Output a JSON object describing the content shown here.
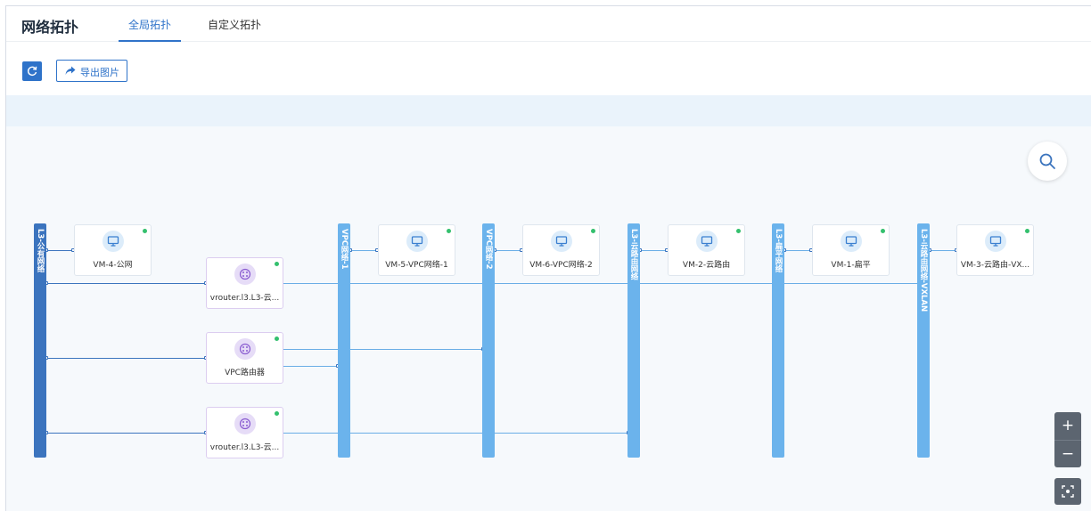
{
  "header": {
    "title": "网络拓扑",
    "tabs": [
      {
        "label": "全局拓扑",
        "active": true
      },
      {
        "label": "自定义拓扑",
        "active": false
      }
    ]
  },
  "toolbar": {
    "refresh_icon": "refresh-icon",
    "export_label": "导出图片",
    "export_icon": "share-arrow-icon"
  },
  "topology": {
    "networks": [
      {
        "label": "L3-公有网络",
        "color": "#3b74be"
      },
      {
        "label": "VPC网络-1",
        "color": "#6bb3ec"
      },
      {
        "label": "VPC网络-2",
        "color": "#6bb3ec"
      },
      {
        "label": "L3-云路由网络",
        "color": "#6bb3ec"
      },
      {
        "label": "L3-扁平网络",
        "color": "#6bb3ec"
      },
      {
        "label": "L3-云路由网络-VXLAN",
        "color": "#6bb3ec"
      }
    ],
    "vms": [
      {
        "label": "VM-4-公网",
        "status": "running"
      },
      {
        "label": "VM-5-VPC网络-1",
        "status": "running"
      },
      {
        "label": "VM-6-VPC网络-2",
        "status": "running"
      },
      {
        "label": "VM-2-云路由",
        "status": "running"
      },
      {
        "label": "VM-1-扁平",
        "status": "running"
      },
      {
        "label": "VM-3-云路由-VX...",
        "status": "running"
      }
    ],
    "routers": [
      {
        "label": "vrouter.l3.L3-云...",
        "status": "running"
      },
      {
        "label": "VPC路由器",
        "status": "running"
      },
      {
        "label": "vrouter.l3.L3-云...",
        "status": "running"
      }
    ],
    "status_color": "#34c06e",
    "vm_icon": "monitor-icon",
    "router_icon": "router-icon"
  },
  "controls": {
    "search_icon": "search-icon",
    "zoom_in": "+",
    "zoom_out": "−",
    "fit_icon": "fit-screen-icon"
  }
}
